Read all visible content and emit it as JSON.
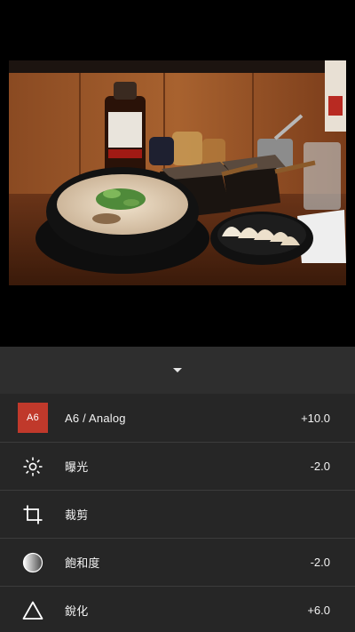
{
  "adjustments": [
    {
      "id": "preset",
      "badge": "A6",
      "label": "A6 / Analog",
      "value": "+10.0",
      "icon": "preset-badge",
      "accent": "#c0392b"
    },
    {
      "id": "exposure",
      "label": "曝光",
      "value": "-2.0",
      "icon": "sun-icon"
    },
    {
      "id": "crop",
      "label": "裁剪",
      "value": "",
      "icon": "crop-icon"
    },
    {
      "id": "saturation",
      "label": "飽和度",
      "value": "-2.0",
      "icon": "saturation-icon"
    },
    {
      "id": "sharpen",
      "label": "銳化",
      "value": "+6.0",
      "icon": "triangle-icon"
    }
  ],
  "colors": {
    "panel_bg": "#2e2e2e",
    "list_bg": "#262626",
    "divider": "#3c3c3c",
    "preset_accent": "#c0392b"
  }
}
